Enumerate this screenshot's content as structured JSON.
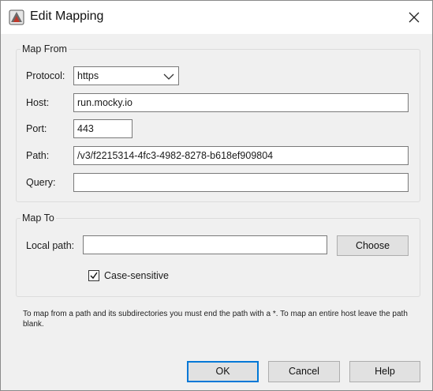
{
  "window": {
    "title": "Edit Mapping",
    "close_label": "×"
  },
  "map_from": {
    "title": "Map From",
    "protocol_label": "Protocol:",
    "protocol_value": "https",
    "host_label": "Host:",
    "host_value": "run.mocky.io",
    "port_label": "Port:",
    "port_value": "443",
    "path_label": "Path:",
    "path_value": "/v3/f2215314-4fc3-4982-8278-b618ef909804",
    "query_label": "Query:",
    "query_value": ""
  },
  "map_to": {
    "title": "Map To",
    "local_path_label": "Local path:",
    "local_path_value": "",
    "choose_label": "Choose",
    "case_sensitive_label": "Case-sensitive",
    "case_sensitive_checked": true
  },
  "note": "To map from a path and its subdirectories you must end the path with a *. To map an entire host leave the path blank.",
  "buttons": {
    "ok": "OK",
    "cancel": "Cancel",
    "help": "Help"
  },
  "colors": {
    "accent": "#0078d7"
  }
}
